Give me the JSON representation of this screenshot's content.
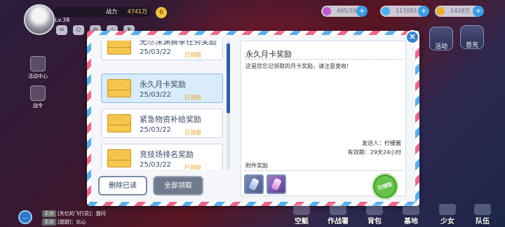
{
  "player": {
    "power_label": "战力",
    "power_value": "4741万",
    "level": "Lv.38",
    "badge": "6"
  },
  "resources": [
    {
      "value": "495/200",
      "icon": "stamina-icon",
      "color": "#c05ad0"
    },
    {
      "value": "117091",
      "icon": "diamond-icon",
      "color": "#4ab0f0"
    },
    {
      "value": "1428万",
      "icon": "gold-coin-icon",
      "color": "#e8b030"
    }
  ],
  "left_menu": [
    {
      "label": "活动中心"
    },
    {
      "label": "战令"
    }
  ],
  "right_menu": [
    {
      "label": "活动"
    },
    {
      "label": "首充"
    }
  ],
  "dialog": {
    "close_label": "×",
    "mail_list": [
      {
        "title": "无尽深渊赛季任务奖励",
        "date": "25/03/22",
        "status": "已领取"
      },
      {
        "title": "永久月卡奖励",
        "date": "25/03/22",
        "status": "已领取"
      },
      {
        "title": "紧急物资补给奖励",
        "date": "25/03/22",
        "status": "已领取"
      },
      {
        "title": "竞技场排名奖励",
        "date": "25/03/22",
        "status": "已领取"
      }
    ],
    "delete_read_label": "删除已读",
    "claim_all_label": "全部领取",
    "detail": {
      "title": "永久月卡奖励",
      "body": "这是您忘记领取的月卡奖励，请注意查收!",
      "sender": "发送人：柠檬酱",
      "validity": "有效期：29天24小时",
      "attachments_label": "附件奖励",
      "attachments": [
        {
          "icon": "blue-ticket-icon"
        },
        {
          "icon": "purple-ticket-icon"
        }
      ],
      "stamp": "已领取"
    }
  },
  "chat": [
    {
      "tag": "系统",
      "text": "[失忆的飞行员]：提问"
    },
    {
      "tag": "系统",
      "text": "[甜甜]：比心"
    }
  ],
  "bottom_nav": [
    {
      "label": "空艇"
    },
    {
      "label": "作战署"
    },
    {
      "label": "背包"
    },
    {
      "label": "基地"
    },
    {
      "label": "少女"
    },
    {
      "label": "队伍"
    }
  ]
}
